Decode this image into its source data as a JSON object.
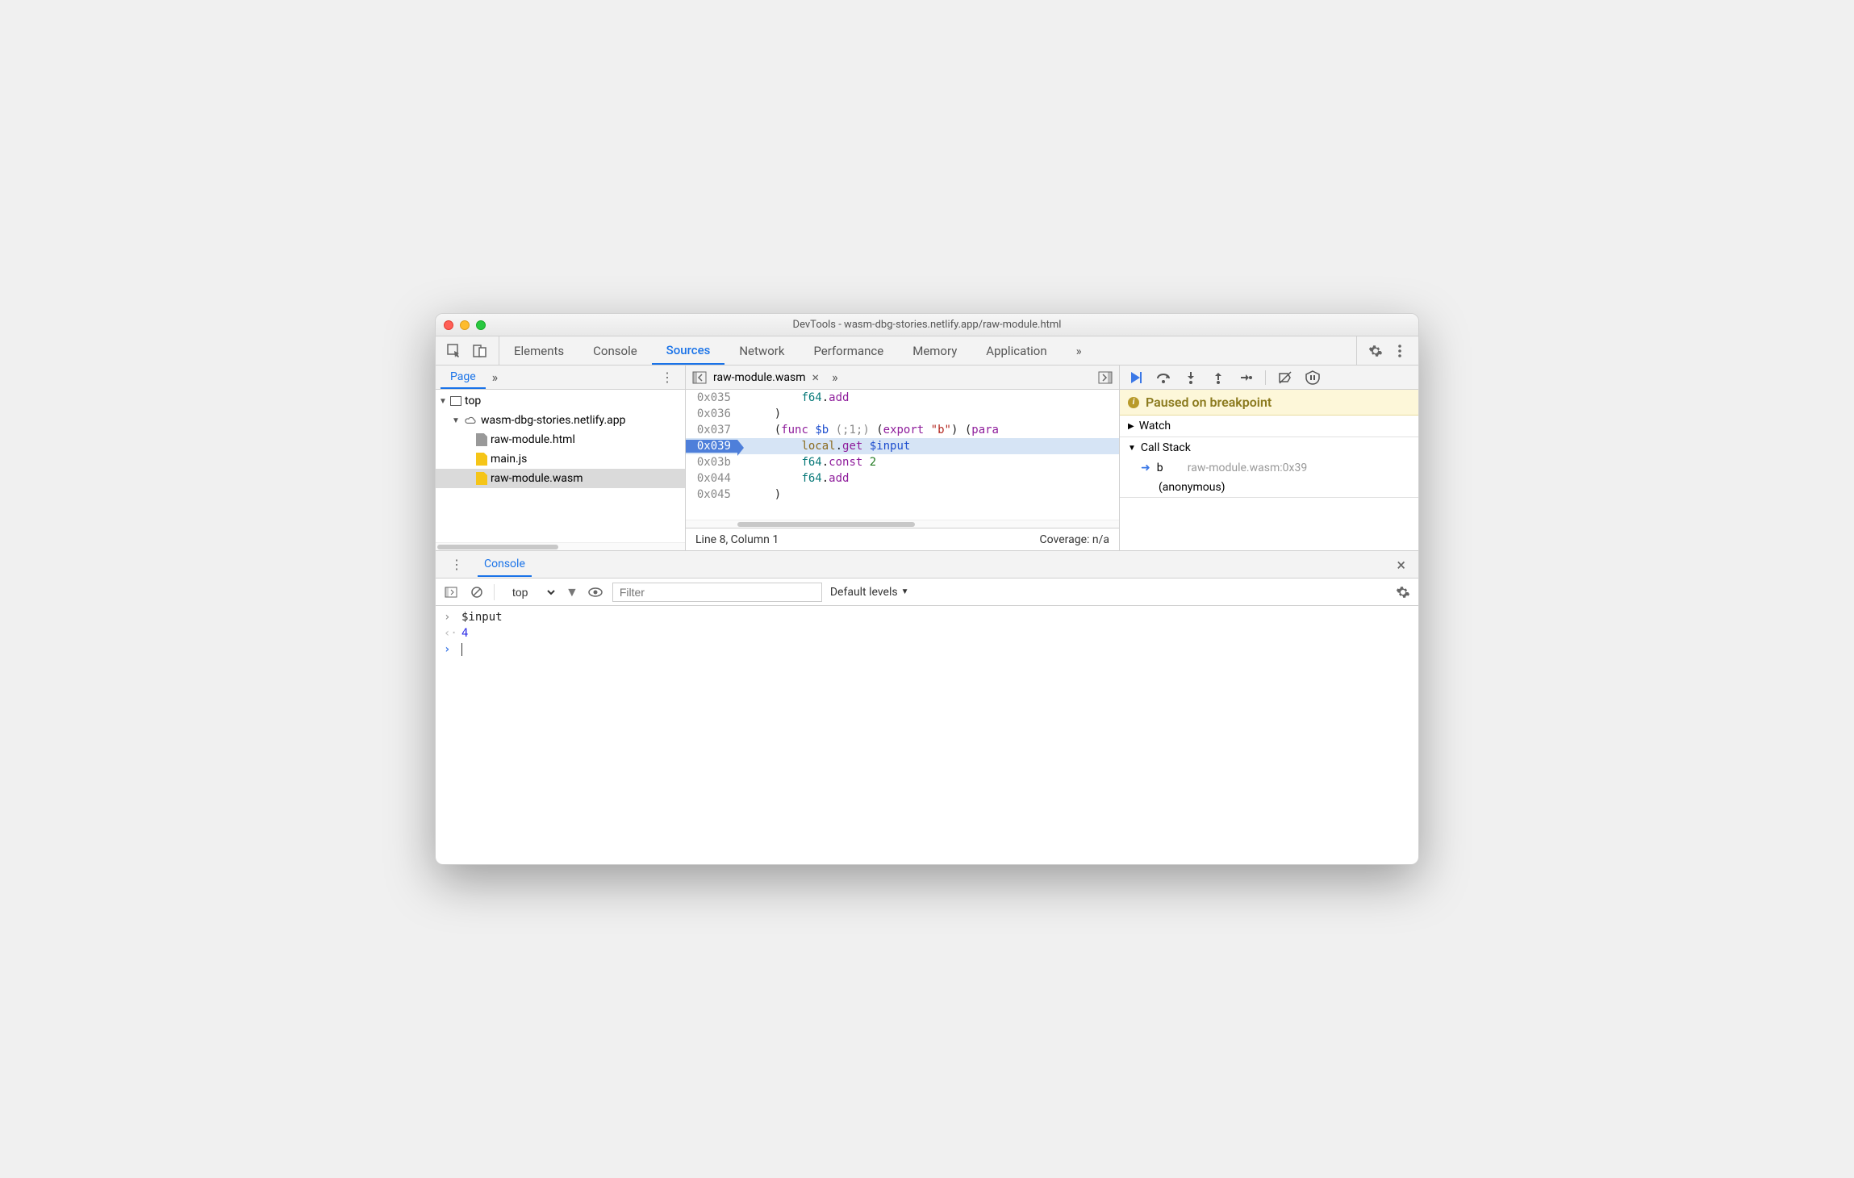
{
  "window": {
    "title": "DevTools - wasm-dbg-stories.netlify.app/raw-module.html"
  },
  "toolbar": {
    "tabs": [
      "Elements",
      "Console",
      "Sources",
      "Network",
      "Performance",
      "Memory",
      "Application"
    ],
    "active": "Sources",
    "overflow": "»"
  },
  "navigator": {
    "tab": "Page",
    "more": "»",
    "tree": {
      "root": {
        "label": "top"
      },
      "domain": {
        "label": "wasm-dbg-stories.netlify.app"
      },
      "files": [
        {
          "label": "raw-module.html",
          "icon": "gray"
        },
        {
          "label": "main.js",
          "icon": "yellow"
        },
        {
          "label": "raw-module.wasm",
          "icon": "yellow",
          "selected": true
        }
      ]
    }
  },
  "editor": {
    "tab": "raw-module.wasm",
    "more": "»",
    "lines": [
      {
        "addr": "0x035",
        "html": "        <span class='kw-teal'>f64</span><span class='paren'>.</span><span class='kw-purple'>add</span>"
      },
      {
        "addr": "0x036",
        "html": "    <span class='paren'>)</span>"
      },
      {
        "addr": "0x037",
        "html": "    <span class='paren'>(</span><span class='kw-purple'>func</span> <span class='kw-blue'>$b</span> <span class='comment'>(;1;)</span> <span class='paren'>(</span><span class='kw-purple'>export</span> <span class='kw-red'>\"b\"</span><span class='paren'>)</span> <span class='paren'>(</span><span class='kw-purple'>para</span>"
      },
      {
        "addr": "0x039",
        "html": "        <span class='kw-brown'>local</span><span class='paren'>.</span><span class='kw-purple'>get</span> <span class='kw-blue'>$input</span>",
        "bp": true,
        "hl": true
      },
      {
        "addr": "0x03b",
        "html": "        <span class='kw-teal'>f64</span><span class='paren'>.</span><span class='kw-purple'>const</span> <span class='num'>2</span>"
      },
      {
        "addr": "0x044",
        "html": "        <span class='kw-teal'>f64</span><span class='paren'>.</span><span class='kw-purple'>add</span>"
      },
      {
        "addr": "0x045",
        "html": "    <span class='paren'>)</span>"
      }
    ],
    "status_left": "Line 8, Column 1",
    "status_right": "Coverage: n/a"
  },
  "debugger": {
    "paused": "Paused on breakpoint",
    "watch_label": "Watch",
    "callstack_label": "Call Stack",
    "callstack": [
      {
        "name": "b",
        "loc": "raw-module.wasm:0x39",
        "current": true
      },
      {
        "name": "(anonymous)",
        "loc": ""
      }
    ]
  },
  "console": {
    "tab": "Console",
    "context": "top",
    "filter_placeholder": "Filter",
    "levels": "Default levels",
    "entries": [
      {
        "type": "in",
        "text": "$input"
      },
      {
        "type": "out",
        "text": "4"
      }
    ]
  }
}
